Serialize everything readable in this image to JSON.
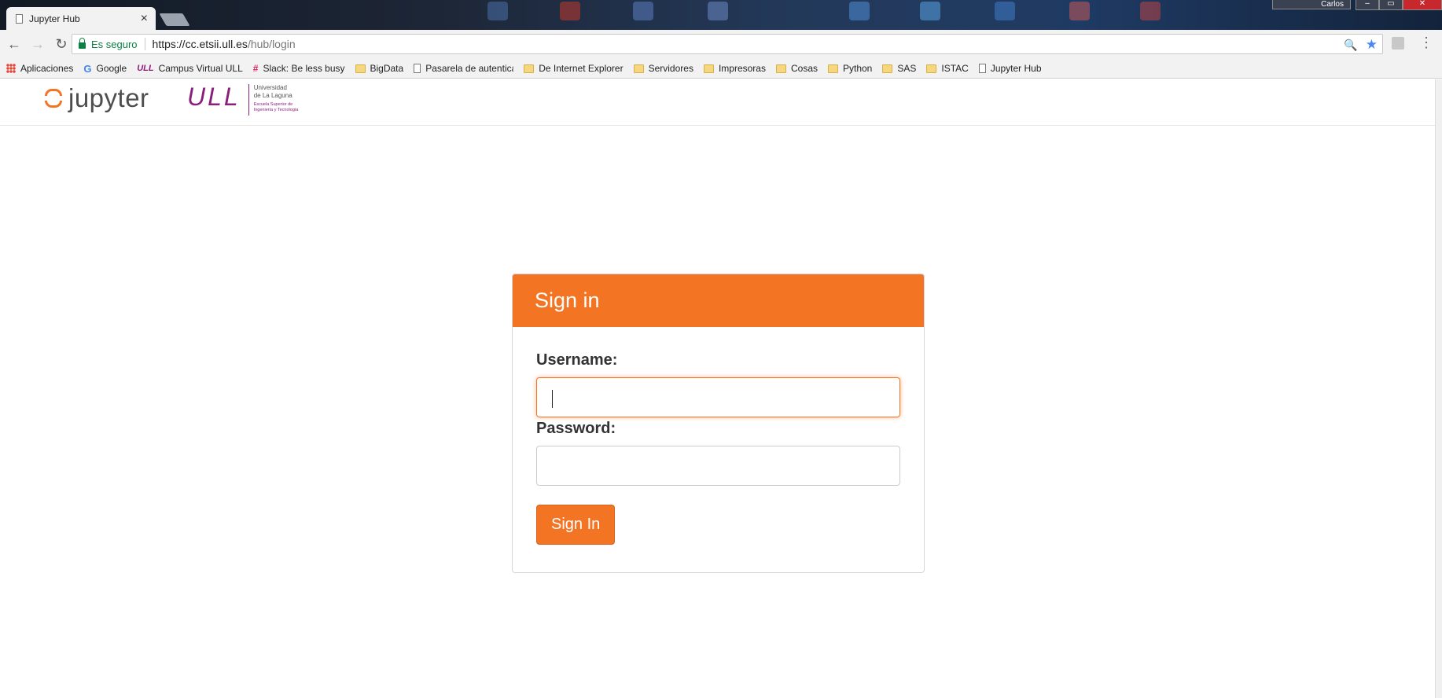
{
  "browser": {
    "tab": {
      "title": "Jupyter Hub",
      "close_glyph": "×",
      "icon": "page-icon"
    },
    "profile_name": "Carlos",
    "window_controls": {
      "minimize": "–",
      "maximize": "▭",
      "close": "✕"
    },
    "nav": {
      "back": "←",
      "forward": "→",
      "reload": "↻"
    },
    "address": {
      "secure_label": "Es seguro",
      "url_host": "https://cc.etsii.ull.es",
      "url_path": "/hub/login",
      "zoom_icon": "🔍",
      "star_icon": "★"
    },
    "menu_glyph": "⋮",
    "bookmarks": [
      {
        "label": "Aplicaciones",
        "icon": "apps-icon"
      },
      {
        "label": "Google",
        "icon": "google-icon",
        "glyph": "G"
      },
      {
        "label": "Campus Virtual ULL",
        "icon": "ull-icon",
        "glyph": "ULL"
      },
      {
        "label": "Slack: Be less busy",
        "icon": "slack-icon",
        "glyph": "#"
      },
      {
        "label": "BigData",
        "icon": "folder-icon"
      },
      {
        "label": "Pasarela de autenticac",
        "icon": "page-icon"
      },
      {
        "label": "De Internet Explorer",
        "icon": "folder-icon"
      },
      {
        "label": "Servidores",
        "icon": "folder-icon"
      },
      {
        "label": "Impresoras",
        "icon": "folder-icon"
      },
      {
        "label": "Cosas",
        "icon": "folder-icon"
      },
      {
        "label": "Python",
        "icon": "folder-icon"
      },
      {
        "label": "SAS",
        "icon": "folder-icon"
      },
      {
        "label": "ISTAC",
        "icon": "folder-icon"
      },
      {
        "label": "Jupyter Hub",
        "icon": "page-icon"
      }
    ]
  },
  "header": {
    "jupyter_text": "jupyter",
    "ull_mark": "ULL",
    "ull_line1": "Universidad",
    "ull_line2": "de La Laguna",
    "ull_sub1": "Escuela Superior de",
    "ull_sub2": "Ingeniería y Tecnología"
  },
  "login": {
    "title": "Sign in",
    "username_label": "Username:",
    "username_value": "",
    "password_label": "Password:",
    "password_value": "",
    "submit_label": "Sign In"
  },
  "colors": {
    "accent": "#f37524",
    "ull_purple": "#8a1f7a",
    "secure_green": "#0b8043",
    "star_blue": "#4a86f4"
  }
}
